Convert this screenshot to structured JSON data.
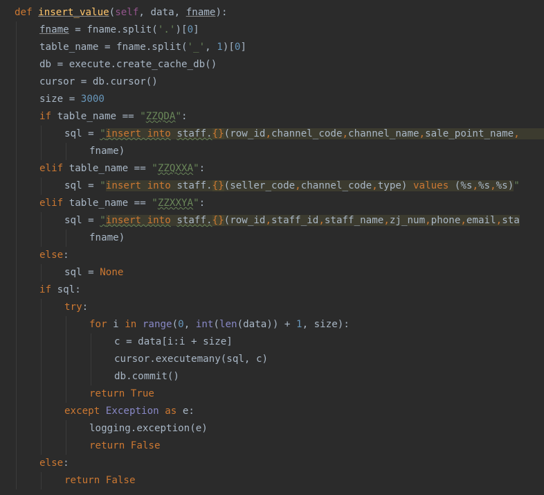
{
  "colors": {
    "background": "#2b2b2b",
    "keyword": "#cc7832",
    "function_name": "#ffc66d",
    "self": "#94558d",
    "number": "#6897bb",
    "string": "#6a8759",
    "plain": "#a9b7c6",
    "builtin": "#8888c6",
    "sql_highlight": "#3c3b2f"
  },
  "code": {
    "lines": [
      {
        "indent": 0,
        "tokens": [
          {
            "t": "def",
            "c": "kw"
          },
          {
            "t": " "
          },
          {
            "t": "insert_value",
            "c": "fn ul"
          },
          {
            "t": "("
          },
          {
            "t": "self",
            "c": "sf"
          },
          {
            "t": ", data, "
          },
          {
            "t": "fname",
            "c": "ul"
          },
          {
            "t": "):"
          }
        ]
      },
      {
        "indent": 1,
        "tokens": [
          {
            "t": "fname",
            "c": "ul"
          },
          {
            "t": " = fname.split("
          },
          {
            "t": "'.'",
            "c": "str"
          },
          {
            "t": ")["
          },
          {
            "t": "0",
            "c": "num"
          },
          {
            "t": "]"
          }
        ]
      },
      {
        "indent": 1,
        "tokens": [
          {
            "t": "table_name = fname.split("
          },
          {
            "t": "'_'",
            "c": "str"
          },
          {
            "t": ", "
          },
          {
            "t": "1",
            "c": "num"
          },
          {
            "t": ")["
          },
          {
            "t": "0",
            "c": "num"
          },
          {
            "t": "]"
          }
        ]
      },
      {
        "indent": 1,
        "tokens": [
          {
            "t": "db = execute.create_cache_db()"
          }
        ]
      },
      {
        "indent": 1,
        "tokens": [
          {
            "t": "cursor = db.cursor()"
          }
        ]
      },
      {
        "indent": 1,
        "tokens": [
          {
            "t": "size = "
          },
          {
            "t": "3000",
            "c": "num"
          }
        ]
      },
      {
        "indent": 1,
        "tokens": [
          {
            "t": "if",
            "c": "kw"
          },
          {
            "t": " table_name == "
          },
          {
            "t": "\"",
            "c": "str"
          },
          {
            "t": "ZZQDA",
            "c": "str wv"
          },
          {
            "t": "\"",
            "c": "str"
          },
          {
            "t": ":"
          }
        ]
      },
      {
        "indent": 2,
        "tokens": [
          {
            "t": "sql = "
          },
          {
            "t": "\"",
            "c": "str wv"
          },
          {
            "t": "insert into",
            "c": "kw hl wv"
          },
          {
            "t": " ",
            "c": "hl"
          },
          {
            "t": "staff.",
            "c": "sp hl wv"
          },
          {
            "t": "{}",
            "c": "kw hlb"
          },
          {
            "t": "(row_id",
            "c": "sp hl"
          },
          {
            "t": ",",
            "c": "kw hl"
          },
          {
            "t": "channel_code",
            "c": "sp hl"
          },
          {
            "t": ",",
            "c": "kw hl"
          },
          {
            "t": "channel_name",
            "c": "sp hl"
          },
          {
            "t": ",",
            "c": "kw hl"
          },
          {
            "t": "sale_point_name",
            "c": "sp hl"
          },
          {
            "t": ",",
            "c": "kw hl"
          },
          {
            "t": "                    ",
            "c": "hl"
          }
        ]
      },
      {
        "indent": 3,
        "tokens": [
          {
            "t": "fname)"
          }
        ]
      },
      {
        "indent": 1,
        "tokens": [
          {
            "t": "elif",
            "c": "kw"
          },
          {
            "t": " table_name == "
          },
          {
            "t": "\"",
            "c": "str"
          },
          {
            "t": "ZZQXXA",
            "c": "str wv"
          },
          {
            "t": "\"",
            "c": "str"
          },
          {
            "t": ":"
          }
        ]
      },
      {
        "indent": 2,
        "tokens": [
          {
            "t": "sql = "
          },
          {
            "t": "\"",
            "c": "str"
          },
          {
            "t": "insert into",
            "c": "kw hl"
          },
          {
            "t": " ",
            "c": "hl"
          },
          {
            "t": "staff.",
            "c": "sp hl"
          },
          {
            "t": "{}",
            "c": "kw hlb"
          },
          {
            "t": "(seller_code",
            "c": "sp hl"
          },
          {
            "t": ",",
            "c": "kw hl"
          },
          {
            "t": "channel_code",
            "c": "sp hl"
          },
          {
            "t": ",",
            "c": "kw hl"
          },
          {
            "t": "type",
            "c": "sp hl"
          },
          {
            "t": ") ",
            "c": "sp hl"
          },
          {
            "t": "values",
            "c": "kw hl"
          },
          {
            "t": " (%s",
            "c": "sp hl"
          },
          {
            "t": ",",
            "c": "kw hl"
          },
          {
            "t": "%s",
            "c": "sp hl"
          },
          {
            "t": ",",
            "c": "kw hl"
          },
          {
            "t": "%s)",
            "c": "sp hl"
          },
          {
            "t": "\"",
            "c": "str"
          }
        ]
      },
      {
        "indent": 1,
        "tokens": [
          {
            "t": "elif",
            "c": "kw"
          },
          {
            "t": " table_name == "
          },
          {
            "t": "\"",
            "c": "str"
          },
          {
            "t": "ZZXXYA",
            "c": "str wv"
          },
          {
            "t": "\"",
            "c": "str"
          },
          {
            "t": ":"
          }
        ]
      },
      {
        "indent": 2,
        "tokens": [
          {
            "t": "sql = "
          },
          {
            "t": "\"",
            "c": "str wv"
          },
          {
            "t": "insert into",
            "c": "kw hl wv"
          },
          {
            "t": " ",
            "c": "hl"
          },
          {
            "t": "staff.",
            "c": "sp hl wv"
          },
          {
            "t": "{}",
            "c": "kw hlb"
          },
          {
            "t": "(row_id",
            "c": "sp hl"
          },
          {
            "t": ",",
            "c": "kw hl"
          },
          {
            "t": "staff_id",
            "c": "sp hl"
          },
          {
            "t": ",",
            "c": "kw hl"
          },
          {
            "t": "staff_name",
            "c": "sp hl"
          },
          {
            "t": ",",
            "c": "kw hl"
          },
          {
            "t": "zj_num",
            "c": "sp hl"
          },
          {
            "t": ",",
            "c": "kw hl"
          },
          {
            "t": "phone",
            "c": "sp hl"
          },
          {
            "t": ",",
            "c": "kw hl"
          },
          {
            "t": "email",
            "c": "sp hl"
          },
          {
            "t": ",",
            "c": "kw hl"
          },
          {
            "t": "sta",
            "c": "sp hl"
          }
        ]
      },
      {
        "indent": 3,
        "tokens": [
          {
            "t": "fname)"
          }
        ]
      },
      {
        "indent": 1,
        "tokens": [
          {
            "t": "else",
            "c": "kw"
          },
          {
            "t": ":"
          }
        ]
      },
      {
        "indent": 2,
        "tokens": [
          {
            "t": "sql = "
          },
          {
            "t": "None",
            "c": "kw"
          }
        ]
      },
      {
        "indent": 1,
        "tokens": [
          {
            "t": "if",
            "c": "kw"
          },
          {
            "t": " sql:"
          }
        ]
      },
      {
        "indent": 2,
        "tokens": [
          {
            "t": "try",
            "c": "kw"
          },
          {
            "t": ":"
          }
        ]
      },
      {
        "indent": 3,
        "tokens": [
          {
            "t": "for",
            "c": "kw"
          },
          {
            "t": " i "
          },
          {
            "t": "in",
            "c": "kw"
          },
          {
            "t": " "
          },
          {
            "t": "range",
            "c": "bi"
          },
          {
            "t": "("
          },
          {
            "t": "0",
            "c": "num"
          },
          {
            "t": ", "
          },
          {
            "t": "int",
            "c": "bi"
          },
          {
            "t": "("
          },
          {
            "t": "len",
            "c": "bi"
          },
          {
            "t": "(data)) + "
          },
          {
            "t": "1",
            "c": "num"
          },
          {
            "t": ", size):"
          }
        ]
      },
      {
        "indent": 4,
        "tokens": [
          {
            "t": "c = data[i:i + size]"
          }
        ]
      },
      {
        "indent": 4,
        "tokens": [
          {
            "t": "cursor.executemany(sql, c)"
          }
        ]
      },
      {
        "indent": 4,
        "tokens": [
          {
            "t": "db.commit()"
          }
        ]
      },
      {
        "indent": 3,
        "tokens": [
          {
            "t": "return",
            "c": "kw"
          },
          {
            "t": " "
          },
          {
            "t": "True",
            "c": "kw"
          }
        ]
      },
      {
        "indent": 2,
        "tokens": [
          {
            "t": "except",
            "c": "kw"
          },
          {
            "t": " "
          },
          {
            "t": "Exception",
            "c": "bi"
          },
          {
            "t": " "
          },
          {
            "t": "as",
            "c": "kw"
          },
          {
            "t": " e:"
          }
        ]
      },
      {
        "indent": 3,
        "tokens": [
          {
            "t": "logging.exception(e)"
          }
        ]
      },
      {
        "indent": 3,
        "tokens": [
          {
            "t": "return",
            "c": "kw"
          },
          {
            "t": " "
          },
          {
            "t": "False",
            "c": "kw"
          }
        ]
      },
      {
        "indent": 1,
        "tokens": [
          {
            "t": "else",
            "c": "kw"
          },
          {
            "t": ":"
          }
        ]
      },
      {
        "indent": 2,
        "tokens": [
          {
            "t": "return",
            "c": "kw"
          },
          {
            "t": " "
          },
          {
            "t": "False",
            "c": "kw"
          }
        ]
      }
    ]
  }
}
